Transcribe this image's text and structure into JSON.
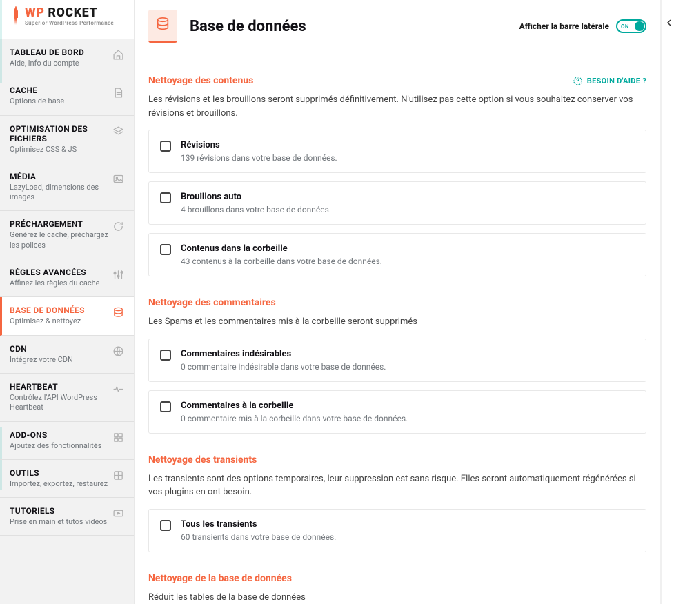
{
  "app": {
    "name_wp": "WP",
    "name_rocket": " ROCKET",
    "tagline": "Superior WordPress Performance"
  },
  "nav": [
    {
      "title": "TABLEAU DE BORD",
      "sub": "Aide, info du compte",
      "icon": "home"
    },
    {
      "title": "CACHE",
      "sub": "Options de base",
      "icon": "doc"
    },
    {
      "title": "OPTIMISATION DES FICHIERS",
      "sub": "Optimisez CSS & JS",
      "icon": "layers"
    },
    {
      "title": "MÉDIA",
      "sub": "LazyLoad, dimensions des images",
      "icon": "image"
    },
    {
      "title": "PRÉCHARGEMENT",
      "sub": "Générez le cache, préchargez les polices",
      "icon": "refresh"
    },
    {
      "title": "RÈGLES AVANCÉES",
      "sub": "Affinez les règles du cache",
      "icon": "sliders"
    },
    {
      "title": "BASE DE DONNÉES",
      "sub": "Optimisez & nettoyez",
      "icon": "database"
    },
    {
      "title": "CDN",
      "sub": "Intégrez votre CDN",
      "icon": "globe"
    },
    {
      "title": "HEARTBEAT",
      "sub": "Contrôlez l'API WordPress Heartbeat",
      "icon": "heartbeat"
    },
    {
      "title": "ADD-ONS",
      "sub": "Ajoutez des fonctionnalités",
      "icon": "puzzle"
    },
    {
      "title": "OUTILS",
      "sub": "Importez, exportez, restaurez",
      "icon": "tools"
    },
    {
      "title": "TUTORIELS",
      "sub": "Prise en main et tutos vidéos",
      "icon": "video"
    }
  ],
  "activeNav": 6,
  "page": {
    "title": "Base de données"
  },
  "sidebarToggle": {
    "label": "Afficher la barre latérale",
    "state": "ON"
  },
  "help": {
    "label": "BESOIN D'AIDE ?"
  },
  "sections": [
    {
      "title": "Nettoyage des contenus",
      "desc": "Les révisions et les brouillons seront supprimés définitivement. N'utilisez pas cette option si vous souhaitez conserver vos révisions et brouillons.",
      "showHelp": true,
      "options": [
        {
          "title": "Révisions",
          "sub": "139 révisions dans votre base de données."
        },
        {
          "title": "Brouillons auto",
          "sub": "4 brouillons dans votre base de données."
        },
        {
          "title": "Contenus dans la corbeille",
          "sub": "43 contenus à la corbeille dans votre base de données."
        }
      ]
    },
    {
      "title": "Nettoyage des commentaires",
      "desc": "Les Spams et les commentaires mis à la corbeille seront supprimés",
      "options": [
        {
          "title": "Commentaires indésirables",
          "sub": "0 commentaire indésirable dans votre base de données."
        },
        {
          "title": "Commentaires à la corbeille",
          "sub": "0 commentaire mis à la corbeille dans votre base de données."
        }
      ]
    },
    {
      "title": "Nettoyage des transients",
      "desc": "Les transients sont des options temporaires, leur suppression est sans risque. Elles seront automatiquement régénérées si vos plugins en ont besoin.",
      "options": [
        {
          "title": "Tous les transients",
          "sub": "60 transients dans votre base de données."
        }
      ]
    },
    {
      "title": "Nettoyage de la base de données",
      "desc": "Réduit les tables de la base de données",
      "options": []
    }
  ]
}
